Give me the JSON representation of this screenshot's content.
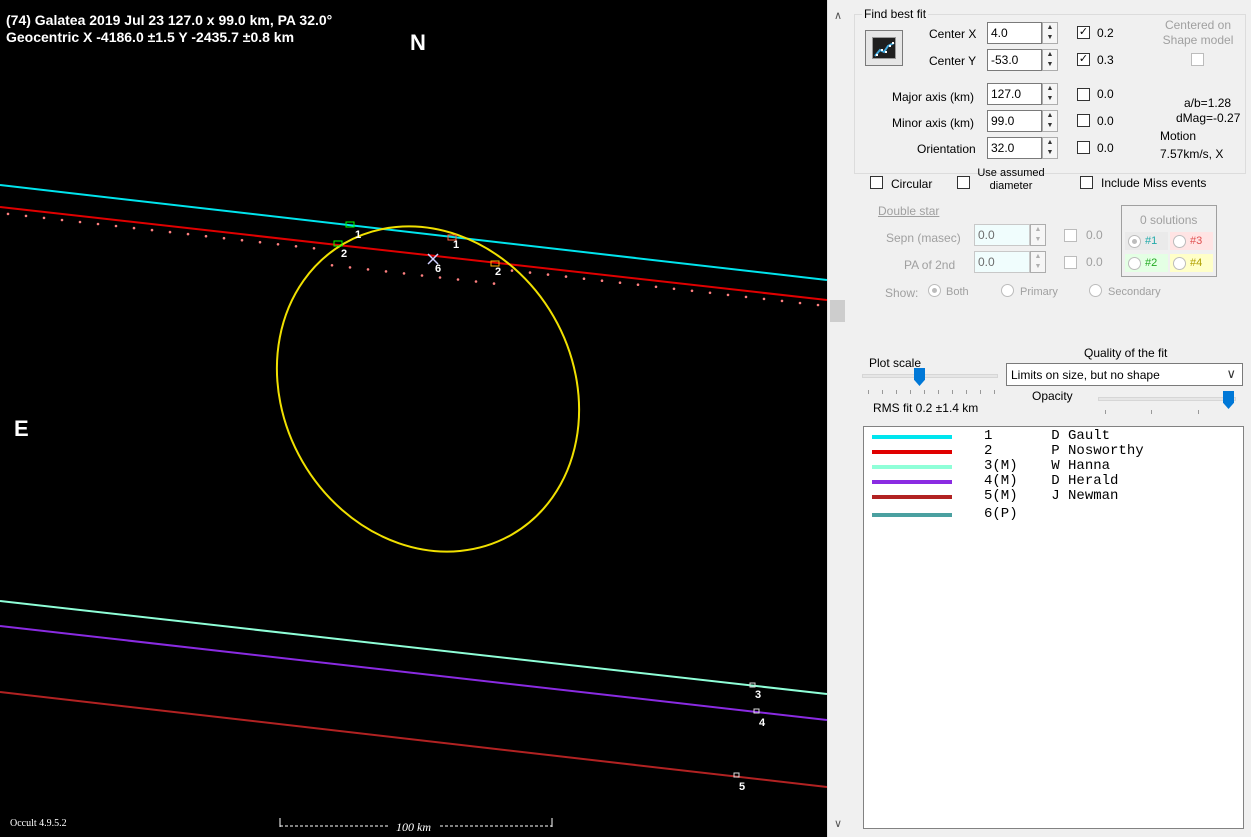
{
  "plot": {
    "title_line1": "(74) Galatea  2019 Jul 23   127.0 x 99.0 km,  PA 32.0°",
    "title_line2": "Geocentric  X  -4186.0 ±1.5  Y -2435.7 ±0.8 km",
    "north_label": "N",
    "east_label": "E",
    "version": "Occult 4.9.5.2",
    "scale_label": "100 km",
    "chord_labels": [
      "1",
      "2",
      "1",
      "2",
      "6",
      "3",
      "4",
      "5"
    ],
    "colors": {
      "background": "#000000",
      "ellipse": "#f0e000",
      "chord1": "#00e5ee",
      "chord2": "#e00000",
      "chord3": "#8fffd8",
      "chord4": "#8a2be2",
      "chord5": "#b22222",
      "chord6": "#4aa0a0"
    }
  },
  "fit": {
    "find_best_fit_label": "Find best fit",
    "center_x_label": "Center X",
    "center_x_value": "4.0",
    "center_x_step": "0.2",
    "center_x_checked": true,
    "center_y_label": "Center Y",
    "center_y_value": "-53.0",
    "center_y_step": "0.3",
    "center_y_checked": true,
    "centered_on_shape_label": "Centered on Shape model",
    "major_axis_label": "Major axis (km)",
    "major_axis_value": "127.0",
    "major_axis_step": "0.0",
    "minor_axis_label": "Minor axis (km)",
    "minor_axis_value": "99.0",
    "minor_axis_step": "0.0",
    "orientation_label": "Orientation",
    "orientation_value": "32.0",
    "orientation_step": "0.0",
    "ab_ratio": "a/b=1.28",
    "dmag": "dMag=-0.27",
    "motion_label": "Motion",
    "motion_value": "7.57km/s, X",
    "circular_label": "Circular",
    "use_assumed_label": "Use assumed diameter",
    "include_miss_label": "Include Miss events"
  },
  "double_star": {
    "title": "Double star",
    "sepn_label": "Sepn (masec)",
    "sepn_value": "0.0",
    "sepn_step": "0.0",
    "pa_label": "PA of 2nd",
    "pa_value": "0.0",
    "pa_step": "0.0",
    "solutions_label": "0 solutions",
    "sol1": "#1",
    "sol2": "#2",
    "sol3": "#3",
    "sol4": "#4",
    "show_label": "Show:",
    "show_both": "Both",
    "show_primary": "Primary",
    "show_secondary": "Secondary"
  },
  "bottom": {
    "plot_scale_label": "Plot scale",
    "quality_label": "Quality of the fit",
    "quality_value": "Limits on size, but no shape",
    "opacity_label": "Opacity",
    "rms_fit": "RMS fit 0.2 ±1.4 km"
  },
  "legend": [
    {
      "text": "1       D Gault",
      "color": "#00e5ee"
    },
    {
      "text": "2       P Nosworthy",
      "color": "#e00000"
    },
    {
      "text": "3(M)    W Hanna",
      "color": "#8fffd8"
    },
    {
      "text": "4(M)    D Herald",
      "color": "#8a2be2"
    },
    {
      "text": "5(M)    J Newman",
      "color": "#b22222"
    },
    {
      "text": "6(P)",
      "color": "#4aa0a0"
    }
  ]
}
